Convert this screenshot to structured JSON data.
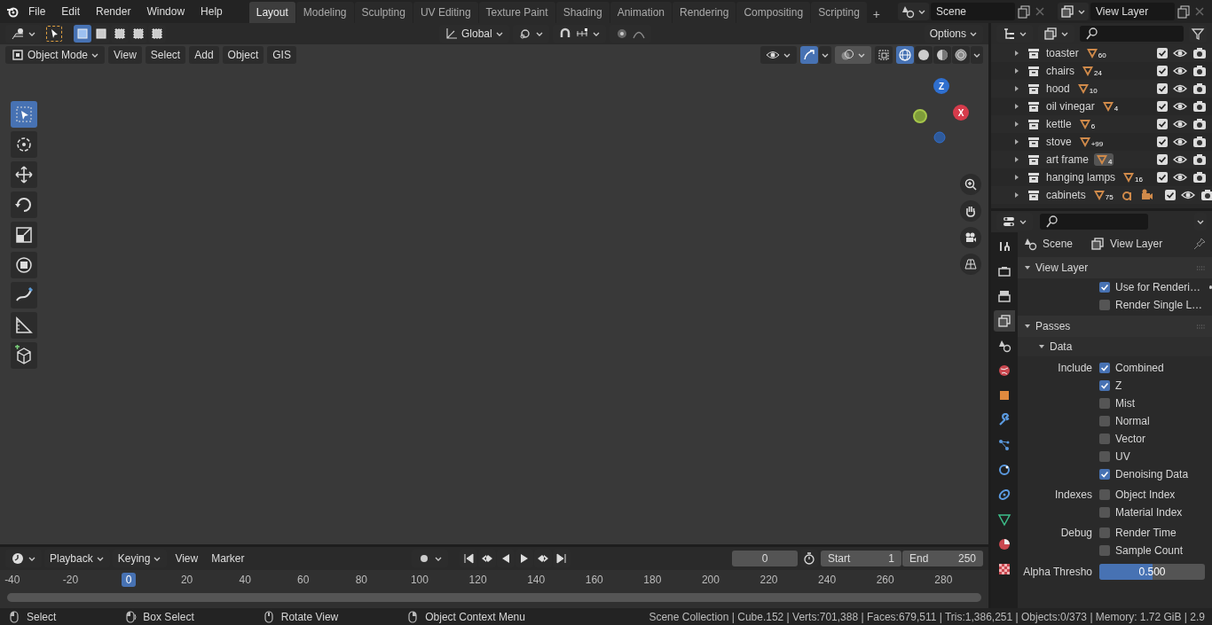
{
  "menu": [
    "File",
    "Edit",
    "Render",
    "Window",
    "Help"
  ],
  "workspaces": [
    {
      "label": "Layout",
      "selected": true
    },
    {
      "label": "Modeling",
      "selected": false
    },
    {
      "label": "Sculpting",
      "selected": false
    },
    {
      "label": "UV Editing",
      "selected": false
    },
    {
      "label": "Texture Paint",
      "selected": false
    },
    {
      "label": "Shading",
      "selected": false
    },
    {
      "label": "Animation",
      "selected": false
    },
    {
      "label": "Rendering",
      "selected": false
    },
    {
      "label": "Compositing",
      "selected": false
    },
    {
      "label": "Scripting",
      "selected": false
    }
  ],
  "add_workspace": "+",
  "scene": "Scene",
  "view_layer": "View Layer",
  "tool_header": {
    "select_modes": [
      {
        "selected": true
      },
      {
        "selected": false
      },
      {
        "selected": false
      },
      {
        "selected": false
      },
      {
        "selected": false
      }
    ],
    "orientation": "Global",
    "proportional_edit": false,
    "options": "Options"
  },
  "viewport_header": {
    "mode": "Object Mode",
    "menus": [
      "View",
      "Select",
      "Add",
      "Object",
      "GIS"
    ],
    "gizmos": true,
    "overlays": true,
    "shading": [
      {
        "kind": "wireframe",
        "selected": true
      },
      {
        "kind": "solid",
        "selected": false
      },
      {
        "kind": "material",
        "selected": false
      },
      {
        "kind": "rendered",
        "selected": false
      }
    ]
  },
  "tools": [
    {
      "kind": "select",
      "selected": true
    },
    {
      "kind": "cursor",
      "selected": false
    },
    {
      "kind": "move",
      "selected": false
    },
    {
      "kind": "rotate",
      "selected": false
    },
    {
      "kind": "scale",
      "selected": false
    },
    {
      "kind": "transform",
      "selected": false
    },
    {
      "kind": "annotate",
      "selected": false
    },
    {
      "kind": "measure",
      "selected": false
    },
    {
      "kind": "add-cube",
      "selected": false
    }
  ],
  "gizmo": {
    "axes": [
      {
        "label": "Z",
        "color": "#2f6fcf"
      },
      {
        "label": "X",
        "color": "#d63b4b"
      }
    ]
  },
  "outliner": {
    "rows": [
      {
        "name": "toaster",
        "count": "60",
        "checked": true,
        "active": false,
        "extra_icons": false
      },
      {
        "name": "chairs",
        "count": "24",
        "checked": true,
        "active": false,
        "extra_icons": false
      },
      {
        "name": "hood",
        "count": "10",
        "checked": true,
        "active": false,
        "extra_icons": false
      },
      {
        "name": "oil vinegar",
        "count": "4",
        "checked": true,
        "active": false,
        "extra_icons": false
      },
      {
        "name": "kettle",
        "count": "6",
        "checked": true,
        "active": false,
        "extra_icons": false
      },
      {
        "name": "stove",
        "count": "+99",
        "checked": true,
        "active": false,
        "extra_icons": false
      },
      {
        "name": "art frame",
        "count": "4",
        "checked": true,
        "active": true,
        "extra_icons": false
      },
      {
        "name": "hanging lamps",
        "count": "16",
        "checked": true,
        "active": false,
        "extra_icons": false
      },
      {
        "name": "cabinets",
        "count": "75",
        "checked": true,
        "active": false,
        "extra_icons": true
      }
    ]
  },
  "properties": {
    "breadcrumb": [
      "Scene",
      "View Layer"
    ],
    "tabs": [
      {
        "kind": "tool",
        "selected": false
      },
      {
        "kind": "render",
        "selected": false
      },
      {
        "kind": "output",
        "selected": false
      },
      {
        "kind": "view-layer",
        "selected": true
      },
      {
        "kind": "scene",
        "selected": false
      },
      {
        "kind": "world",
        "selected": false
      },
      {
        "kind": "object",
        "selected": false
      },
      {
        "kind": "modifier",
        "selected": false
      },
      {
        "kind": "particles",
        "selected": false
      },
      {
        "kind": "physics",
        "selected": false
      },
      {
        "kind": "constraint",
        "selected": false
      },
      {
        "kind": "data",
        "selected": false
      },
      {
        "kind": "material",
        "selected": false
      },
      {
        "kind": "texture",
        "selected": false
      }
    ],
    "items": [
      {
        "kind": "panel",
        "title": "View Layer",
        "expanded": true
      },
      {
        "kind": "checkbox",
        "label": "Use for Renderi…",
        "checked": true,
        "indicator": true
      },
      {
        "kind": "checkbox",
        "label": "Render Single L…",
        "checked": false,
        "indicator": false
      },
      {
        "kind": "panel",
        "title": "Passes",
        "expanded": true
      },
      {
        "kind": "subpanel",
        "title": "Data",
        "expanded": true
      },
      {
        "kind": "checkbox",
        "group": "Include",
        "label": "Combined",
        "checked": true,
        "indicator": false
      },
      {
        "kind": "checkbox",
        "label": "Z",
        "checked": true,
        "indicator": false
      },
      {
        "kind": "checkbox",
        "label": "Mist",
        "checked": false,
        "indicator": false
      },
      {
        "kind": "checkbox",
        "label": "Normal",
        "checked": false,
        "indicator": false
      },
      {
        "kind": "checkbox",
        "label": "Vector",
        "checked": false,
        "indicator": false
      },
      {
        "kind": "checkbox",
        "label": "UV",
        "checked": false,
        "indicator": false
      },
      {
        "kind": "checkbox",
        "label": "Denoising Data",
        "checked": true,
        "indicator": false
      },
      {
        "kind": "checkbox",
        "group": "Indexes",
        "label": "Object Index",
        "checked": false,
        "indicator": false
      },
      {
        "kind": "checkbox",
        "label": "Material Index",
        "checked": false,
        "indicator": false
      },
      {
        "kind": "checkbox",
        "group": "Debug",
        "label": "Render Time",
        "checked": false,
        "indicator": false
      },
      {
        "kind": "checkbox",
        "label": "Sample Count",
        "checked": false,
        "indicator": false
      },
      {
        "kind": "slider",
        "label": "Alpha Thresho",
        "value": "0.500",
        "level": 0.5
      }
    ]
  },
  "timeline": {
    "menus": [
      {
        "kind": "dropdown",
        "label": "Playback"
      },
      {
        "kind": "dropdown",
        "label": "Keying"
      },
      {
        "kind": "menu",
        "label": "View"
      },
      {
        "kind": "menu",
        "label": "Marker"
      }
    ],
    "auto_keying": false,
    "current_frame": "0",
    "start_label": "Start",
    "start": "1",
    "end_label": "End",
    "end": "250",
    "ruler": [
      {
        "kind": "tick",
        "label": "-40"
      },
      {
        "kind": "tick",
        "label": "-20"
      },
      {
        "kind": "playhead",
        "label": "0"
      },
      {
        "kind": "tick",
        "label": "20"
      },
      {
        "kind": "tick",
        "label": "40"
      },
      {
        "kind": "tick",
        "label": "60"
      },
      {
        "kind": "tick",
        "label": "80"
      },
      {
        "kind": "tick",
        "label": "100"
      },
      {
        "kind": "tick",
        "label": "120"
      },
      {
        "kind": "tick",
        "label": "140"
      },
      {
        "kind": "tick",
        "label": "160"
      },
      {
        "kind": "tick",
        "label": "180"
      },
      {
        "kind": "tick",
        "label": "200"
      },
      {
        "kind": "tick",
        "label": "220"
      },
      {
        "kind": "tick",
        "label": "240"
      },
      {
        "kind": "tick",
        "label": "260"
      },
      {
        "kind": "tick",
        "label": "280"
      }
    ]
  },
  "status_bar": {
    "hints": [
      {
        "kind": "left-click",
        "label": "Select"
      },
      {
        "kind": "drag",
        "label": "Box Select"
      },
      {
        "kind": "middle-click",
        "label": "Rotate View"
      },
      {
        "kind": "right-click",
        "label": "Object Context Menu"
      }
    ],
    "stats": "Scene Collection | Cube.152 | Verts:701,388 | Faces:679,511 | Tris:1,386,251 | Objects:0/373 | Memory: 1.72 GiB | 2.9"
  }
}
